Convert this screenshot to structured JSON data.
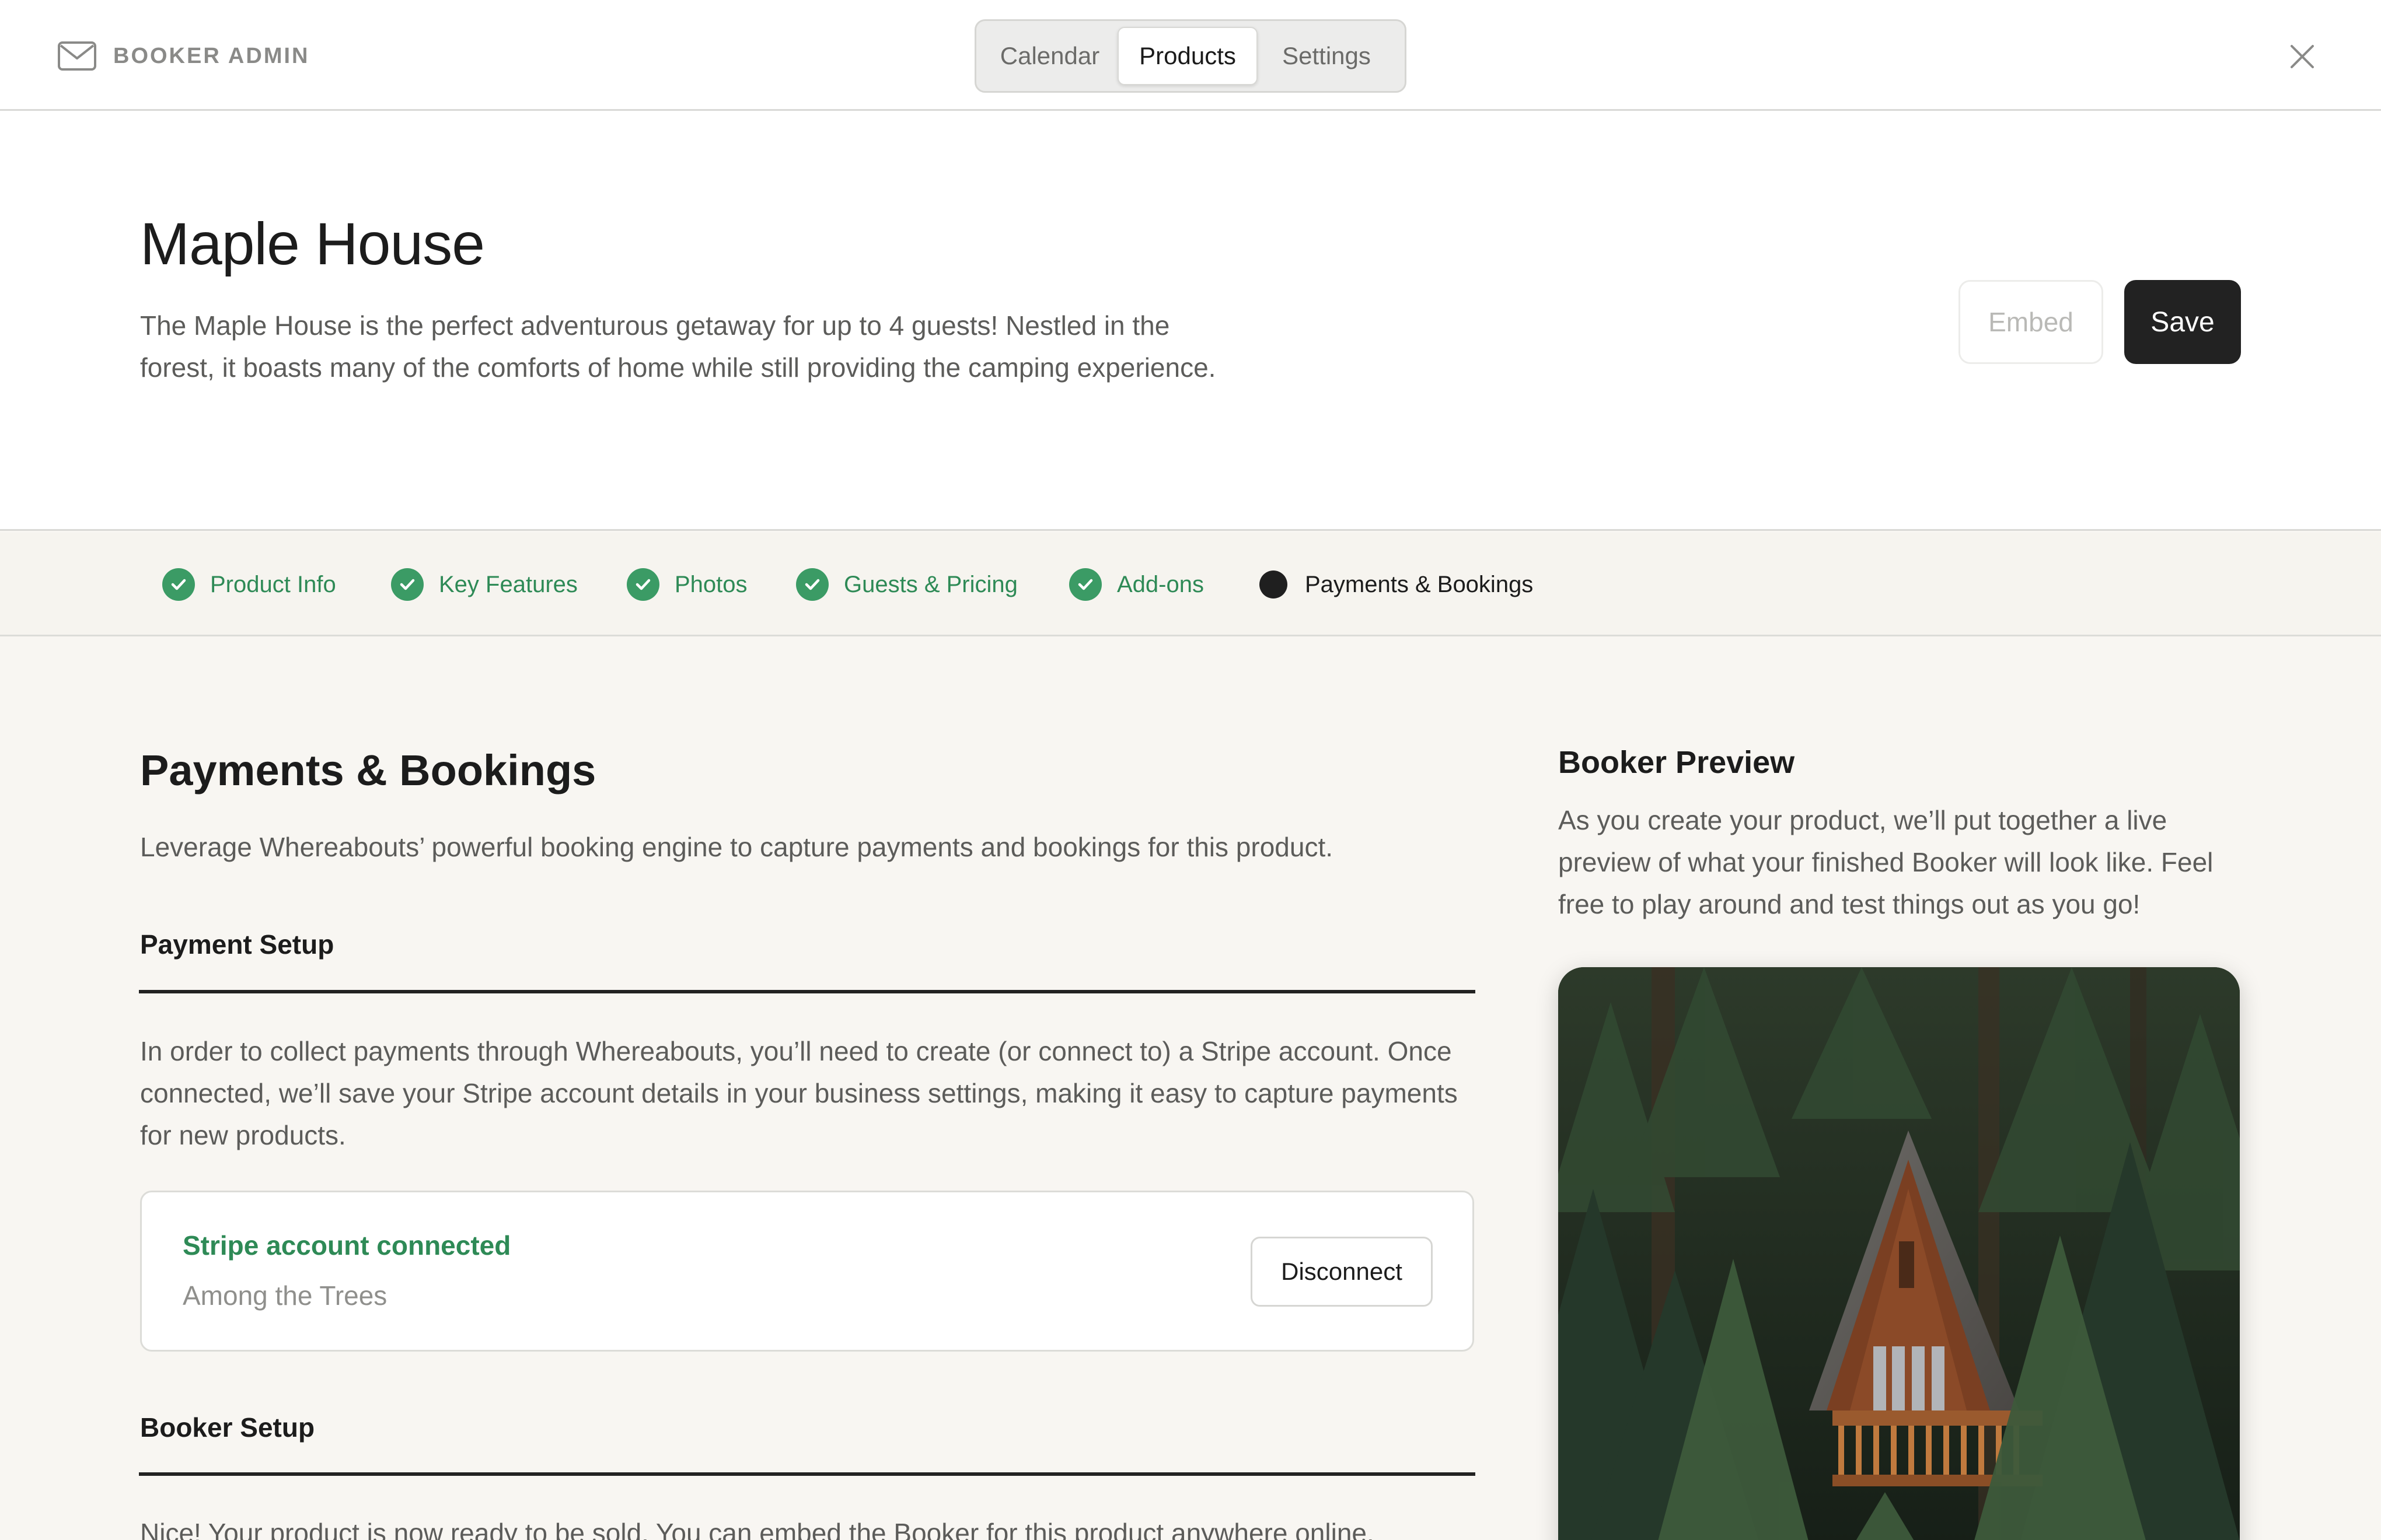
{
  "brand": {
    "label": "BOOKER ADMIN",
    "icon": "envelope-icon"
  },
  "nav": {
    "tabs": [
      {
        "label": "Calendar",
        "active": false
      },
      {
        "label": "Products",
        "active": true
      },
      {
        "label": "Settings",
        "active": false
      }
    ],
    "close_icon": "close-icon"
  },
  "product": {
    "title": "Maple House",
    "description": "The Maple House is the perfect adventurous getaway for up to 4 guests! Nestled in the forest, it boasts many of the comforts of home while still providing the camping experience.",
    "embed_label": "Embed",
    "save_label": "Save"
  },
  "steps": [
    {
      "label": "Product Info",
      "status": "complete"
    },
    {
      "label": "Key Features",
      "status": "complete"
    },
    {
      "label": "Photos",
      "status": "complete"
    },
    {
      "label": "Guests & Pricing",
      "status": "complete"
    },
    {
      "label": "Add-ons",
      "status": "complete"
    },
    {
      "label": "Payments & Bookings",
      "status": "current"
    }
  ],
  "main": {
    "title": "Payments & Bookings",
    "description": "Leverage Whereabouts’ powerful booking engine to capture payments and bookings for this product.",
    "payment_setup": {
      "heading": "Payment Setup",
      "text": "In order to collect payments through Whereabouts, you’ll need to create (or connect to) a Stripe account. Once connected, we’ll save your Stripe account details in your business settings, making it easy to capture payments for new products.",
      "stripe": {
        "status": "Stripe account connected",
        "account_name": "Among the Trees",
        "disconnect_label": "Disconnect"
      }
    },
    "booker_setup": {
      "heading": "Booker Setup",
      "text": "Nice! Your product is now ready to be sold. You can embed the Booker for this product anywhere online."
    }
  },
  "preview": {
    "title": "Booker Preview",
    "description": "As you create your product, we’ll put together a live preview of what your finished Booker will look like. Feel free to play around and test things out as you go!"
  },
  "colors": {
    "success_green": "#2e8a56",
    "check_green": "#3b9b65",
    "dark": "#222222",
    "page_bg": "#f8f6f2"
  }
}
